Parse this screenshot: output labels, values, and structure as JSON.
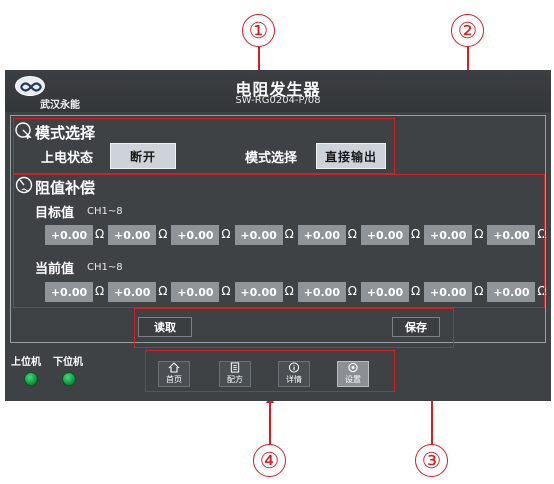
{
  "callouts": [
    "①",
    "②",
    "③",
    "④"
  ],
  "header": {
    "logo_text": "武汉永能",
    "title": "电阻发生器",
    "subtitle": "SW-RG0204-P/08"
  },
  "mode_section": {
    "title": "模式选择",
    "power_state_label": "上电状态",
    "power_state_value": "断开",
    "mode_label": "模式选择",
    "mode_value": "直接输出"
  },
  "comp_section": {
    "title": "阻值补偿",
    "target_label": "目标值",
    "target_channels": "CH1~8",
    "target_values": [
      "+0.00",
      "+0.00",
      "+0.00",
      "+0.00",
      "+0.00",
      "+0.00",
      "+0.00",
      "+0.00"
    ],
    "current_label": "当前值",
    "current_channels": "CH1~8",
    "current_values": [
      "+0.00",
      "+0.00",
      "+0.00",
      "+0.00",
      "+0.00",
      "+0.00",
      "+0.00",
      "+0.00"
    ],
    "unit": "Ω"
  },
  "actions": {
    "read": "读取",
    "save": "保存"
  },
  "status": {
    "upper_label": "上位机",
    "lower_label": "下位机",
    "led_color": "#2fc765"
  },
  "nav": [
    {
      "label": "首页",
      "icon": "home-icon"
    },
    {
      "label": "配方",
      "icon": "recipe-icon"
    },
    {
      "label": "详情",
      "icon": "info-icon"
    },
    {
      "label": "设置",
      "icon": "settings-icon"
    }
  ],
  "colors": {
    "annotation": "#d32020",
    "screen_bg": "#3f4245",
    "value_box": "#8f9499"
  }
}
